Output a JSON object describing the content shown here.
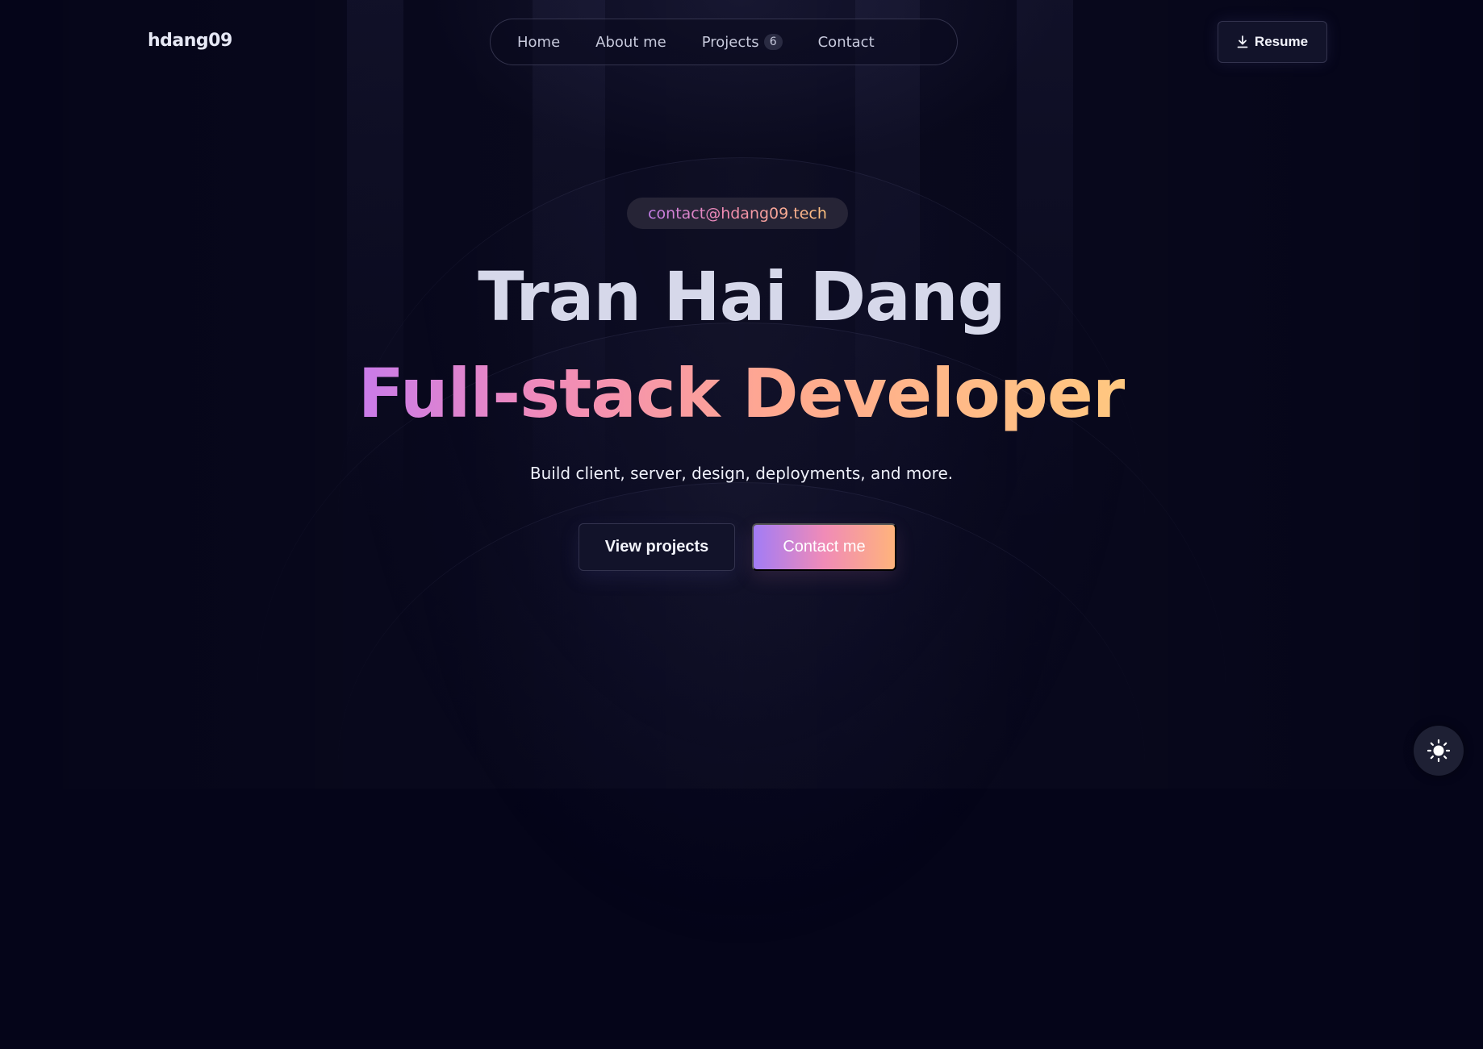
{
  "header": {
    "logo": "hdang09",
    "nav": [
      {
        "label": "Home"
      },
      {
        "label": "About me"
      },
      {
        "label": "Projects",
        "badge": "6"
      },
      {
        "label": "Contact"
      }
    ],
    "resume_label": "Resume",
    "resume_icon": "download-icon"
  },
  "hero": {
    "email": "contact@hdang09.tech",
    "name": "Tran Hai Dang",
    "role": "Full-stack Developer",
    "tagline": "Build client, server, design, deployments, and more.",
    "view_projects_label": "View projects",
    "contact_label": "Contact me"
  },
  "theme_toggle": {
    "icon": "sun-icon"
  },
  "colors": {
    "background": "#050519",
    "gradient_start": "#c97bea",
    "gradient_mid": "#f18bb8",
    "gradient_end": "#ffc880"
  }
}
